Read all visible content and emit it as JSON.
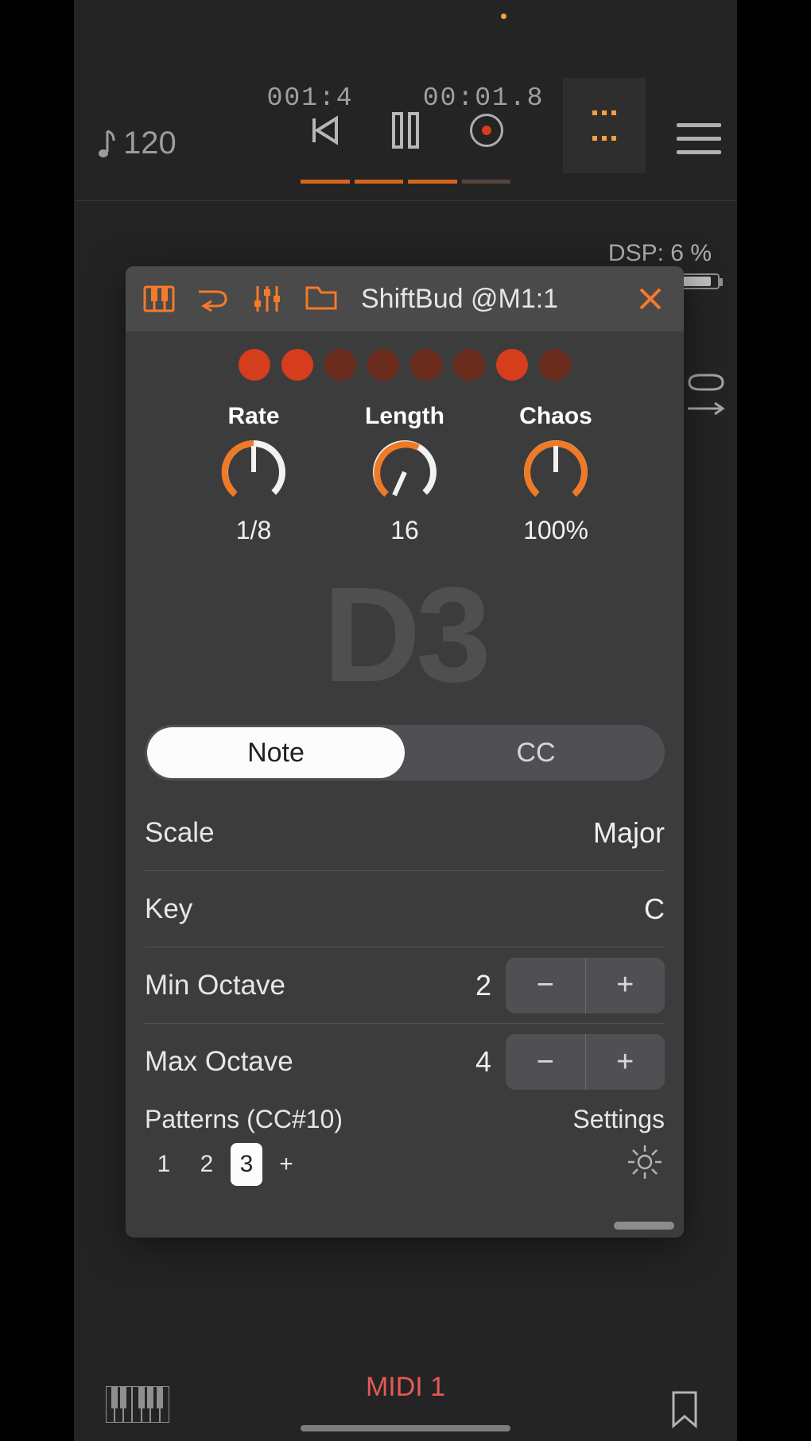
{
  "transport": {
    "position": "001:4",
    "time": "00:01.8",
    "tempo": "120"
  },
  "dsp": {
    "label": "DSP:",
    "value": "6 %"
  },
  "panel": {
    "title": "ShiftBud @M1:1",
    "steps": [
      true,
      true,
      false,
      false,
      false,
      false,
      true,
      false
    ],
    "knobs": {
      "rate": {
        "label": "Rate",
        "value": "1/8"
      },
      "length": {
        "label": "Length",
        "value": "16"
      },
      "chaos": {
        "label": "Chaos",
        "value": "100%"
      }
    },
    "current_note": "D3",
    "tabs": {
      "note": "Note",
      "cc": "CC",
      "active": "note"
    },
    "scale": {
      "label": "Scale",
      "value": "Major"
    },
    "key": {
      "label": "Key",
      "value": "C"
    },
    "min_octave": {
      "label": "Min Octave",
      "value": "2"
    },
    "max_octave": {
      "label": "Max Octave",
      "value": "4"
    },
    "patterns_label": "Patterns (CC#10)",
    "settings_label": "Settings",
    "patterns": [
      "1",
      "2",
      "3"
    ],
    "pattern_active_index": 2,
    "add_pattern": "+"
  },
  "footer": {
    "midi_label": "MIDI 1"
  },
  "glyphs": {
    "minus": "−",
    "plus": "+"
  }
}
